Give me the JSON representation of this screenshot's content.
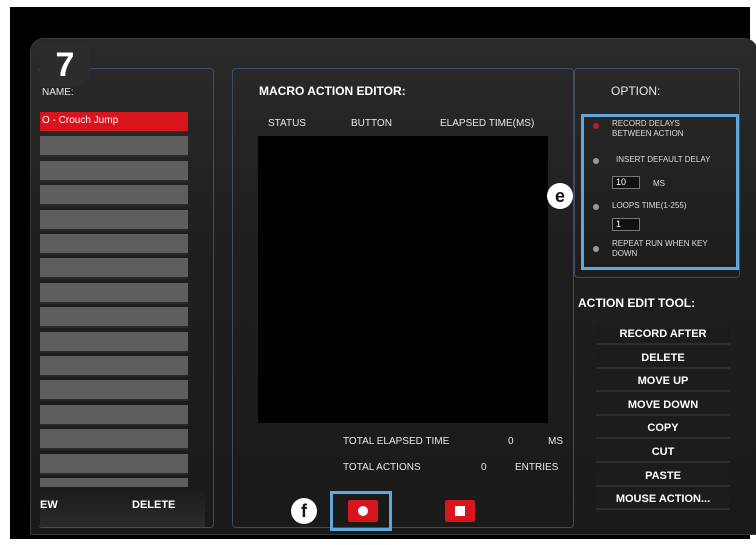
{
  "step_badge": "7",
  "left_panel": {
    "name_header": "NAME:",
    "macros": [
      "O - Crouch Jump",
      "",
      "",
      "",
      "",
      "",
      "",
      "",
      "",
      "",
      "",
      "",
      "",
      "",
      "",
      ""
    ],
    "new_label": "EW",
    "delete_label": "DELETE"
  },
  "editor": {
    "title": "MACRO ACTION EDITOR:",
    "col_status": "STATUS",
    "col_button": "BUTTON",
    "col_elapsed": "ELAPSED TIME(MS)",
    "total_elapsed_label": "TOTAL ELAPSED TIME",
    "total_elapsed_value": "0",
    "total_elapsed_unit": "MS",
    "total_actions_label": "TOTAL ACTIONS",
    "total_actions_value": "0",
    "total_actions_unit": "ENTRIES"
  },
  "options": {
    "title": "OPTION:",
    "record_delays_line1": "RECORD DELAYS",
    "record_delays_line2": "BETWEEN ACTION",
    "insert_default_delay": "INSERT DEFAULT DELAY",
    "delay_value": "10",
    "delay_unit": "MS",
    "loops_time": "LOOPS TIME(1-255)",
    "loops_value": "1",
    "repeat_line1": "REPEAT RUN WHEN KEY",
    "repeat_line2": "DOWN"
  },
  "tools": {
    "title": "ACTION EDIT TOOL:",
    "items": [
      "RECORD AFTER",
      "DELETE",
      "MOVE UP",
      "MOVE DOWN",
      "COPY",
      "CUT",
      "PASTE",
      "MOUSE ACTION..."
    ]
  },
  "callouts": {
    "e": "e",
    "f": "f"
  },
  "colors": {
    "accent_red": "#d8141c",
    "highlight_blue": "#5ea8dc"
  }
}
